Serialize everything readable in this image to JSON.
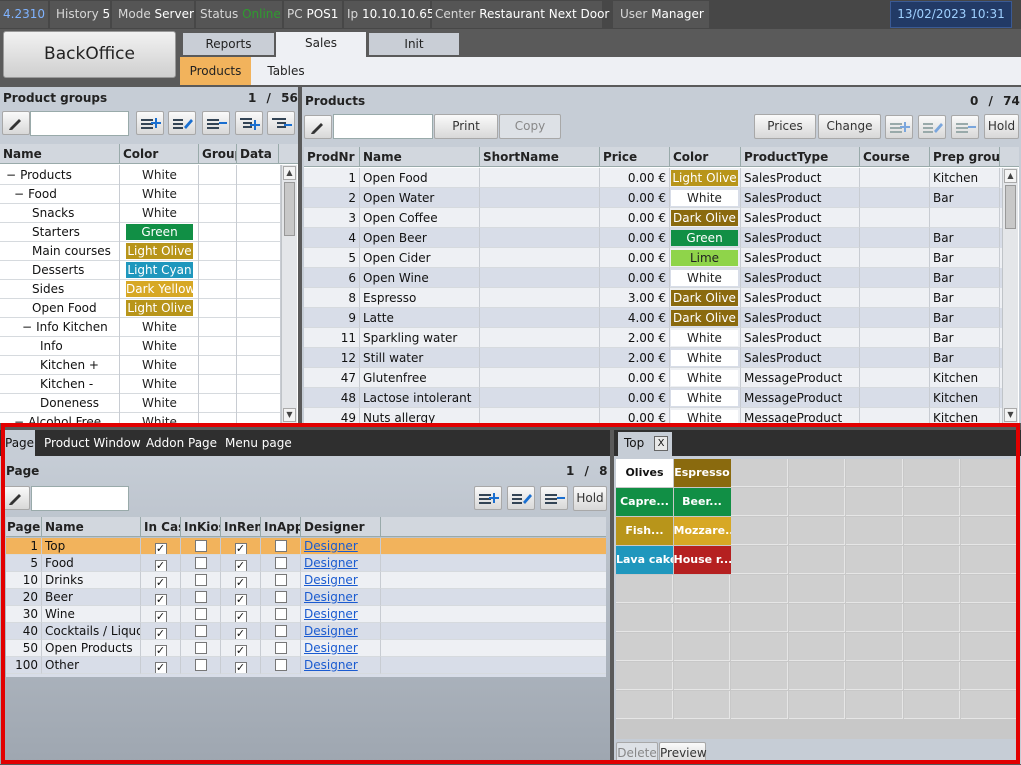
{
  "topbar": {
    "version": "4.2310",
    "history_label": "History",
    "history_value": "5",
    "mode_label": "Mode",
    "mode_value": "Server",
    "status_label": "Status",
    "status_value": "Online",
    "pc_label": "PC",
    "pc_value": "POS1",
    "ip_label": "Ip",
    "ip_value": "10.10.10.65",
    "center_label": "Center",
    "center_value": "Restaurant Next Door",
    "user_label": "User",
    "user_value": "Manager",
    "datetime": "13/02/2023 10:31"
  },
  "backoffice_label": "BackOffice",
  "main_tabs": [
    {
      "label": "Reports",
      "active": false
    },
    {
      "label": "Sales",
      "active": true
    },
    {
      "label": "Init",
      "active": false
    }
  ],
  "sub_tabs": [
    {
      "label": "Products",
      "active": true
    },
    {
      "label": "Tables",
      "active": false
    }
  ],
  "product_groups": {
    "title": "Product groups",
    "count": "1 / 56",
    "columns": [
      "Name",
      "Color",
      "Group",
      "Data"
    ],
    "rows": [
      {
        "name": "Products",
        "prefix": "−",
        "color": "White",
        "bg": "#ffffff",
        "fg": "#222"
      },
      {
        "name": "Food",
        "prefix": "−",
        "color": "White",
        "bg": "#ffffff",
        "fg": "#222"
      },
      {
        "name": "Snacks",
        "prefix": "",
        "color": "White",
        "bg": "#ffffff",
        "fg": "#222"
      },
      {
        "name": "Starters",
        "prefix": "",
        "color": "Green",
        "bg": "#118f45",
        "fg": "#ffffff"
      },
      {
        "name": "Main courses",
        "prefix": "",
        "color": "Light Olive",
        "bg": "#b8951a",
        "fg": "#ffffff"
      },
      {
        "name": "Desserts",
        "prefix": "",
        "color": "Light Cyan",
        "bg": "#1f97bd",
        "fg": "#ffffff"
      },
      {
        "name": "Sides",
        "prefix": "",
        "color": "Dark Yellow",
        "bg": "#d7a825",
        "fg": "#ffffff"
      },
      {
        "name": "Open Food",
        "prefix": "",
        "color": "Light Olive",
        "bg": "#b8951a",
        "fg": "#ffffff"
      },
      {
        "name": "Info Kitchen",
        "prefix": "−",
        "color": "White",
        "bg": "#ffffff",
        "fg": "#222"
      },
      {
        "name": "Info",
        "prefix": "",
        "color": "White",
        "bg": "#ffffff",
        "fg": "#222"
      },
      {
        "name": "Kitchen +",
        "prefix": "",
        "color": "White",
        "bg": "#ffffff",
        "fg": "#222"
      },
      {
        "name": "Kitchen -",
        "prefix": "",
        "color": "White",
        "bg": "#ffffff",
        "fg": "#222"
      },
      {
        "name": "Doneness",
        "prefix": "",
        "color": "White",
        "bg": "#ffffff",
        "fg": "#222"
      },
      {
        "name": "Alcohol Free",
        "prefix": "−",
        "color": "White",
        "bg": "#ffffff",
        "fg": "#222"
      }
    ]
  },
  "products": {
    "title": "Products",
    "count": "0 / 74",
    "buttons": {
      "print": "Print",
      "copy": "Copy",
      "prices": "Prices",
      "change": "Change",
      "hold": "Hold"
    },
    "columns": [
      "ProdNr",
      "Name",
      "ShortName",
      "Price",
      "Color",
      "ProductType",
      "Course",
      "Prep group"
    ],
    "rows": [
      {
        "nr": "1",
        "name": "Open Food",
        "short": "",
        "price": "0.00 €",
        "color": "Light Olive",
        "bg": "#b8951a",
        "fg": "#fff",
        "type": "SalesProduct",
        "course": "",
        "prep": "Kitchen"
      },
      {
        "nr": "2",
        "name": "Open Water",
        "short": "",
        "price": "0.00 €",
        "color": "White",
        "bg": "#fff",
        "fg": "#222",
        "type": "SalesProduct",
        "course": "",
        "prep": "Bar"
      },
      {
        "nr": "3",
        "name": "Open Coffee",
        "short": "",
        "price": "0.00 €",
        "color": "Dark Olive",
        "bg": "#8a6a0e",
        "fg": "#fff",
        "type": "SalesProduct",
        "course": "",
        "prep": ""
      },
      {
        "nr": "4",
        "name": "Open Beer",
        "short": "",
        "price": "0.00 €",
        "color": "Green",
        "bg": "#118f45",
        "fg": "#fff",
        "type": "SalesProduct",
        "course": "",
        "prep": "Bar"
      },
      {
        "nr": "5",
        "name": "Open Cider",
        "short": "",
        "price": "0.00 €",
        "color": "Lime",
        "bg": "#8fd44a",
        "fg": "#222",
        "type": "SalesProduct",
        "course": "",
        "prep": "Bar"
      },
      {
        "nr": "6",
        "name": "Open Wine",
        "short": "",
        "price": "0.00 €",
        "color": "White",
        "bg": "#fff",
        "fg": "#222",
        "type": "SalesProduct",
        "course": "",
        "prep": "Bar"
      },
      {
        "nr": "8",
        "name": "Espresso",
        "short": "",
        "price": "3.00 €",
        "color": "Dark Olive",
        "bg": "#8a6a0e",
        "fg": "#fff",
        "type": "SalesProduct",
        "course": "",
        "prep": "Bar"
      },
      {
        "nr": "9",
        "name": "Latte",
        "short": "",
        "price": "4.00 €",
        "color": "Dark Olive",
        "bg": "#8a6a0e",
        "fg": "#fff",
        "type": "SalesProduct",
        "course": "",
        "prep": "Bar"
      },
      {
        "nr": "11",
        "name": "Sparkling water",
        "short": "",
        "price": "2.00 €",
        "color": "White",
        "bg": "#fff",
        "fg": "#222",
        "type": "SalesProduct",
        "course": "",
        "prep": "Bar"
      },
      {
        "nr": "12",
        "name": "Still water",
        "short": "",
        "price": "2.00 €",
        "color": "White",
        "bg": "#fff",
        "fg": "#222",
        "type": "SalesProduct",
        "course": "",
        "prep": "Bar"
      },
      {
        "nr": "47",
        "name": "Glutenfree",
        "short": "",
        "price": "0.00 €",
        "color": "White",
        "bg": "#fff",
        "fg": "#222",
        "type": "MessageProduct",
        "course": "",
        "prep": "Kitchen"
      },
      {
        "nr": "48",
        "name": "Lactose intolerant",
        "short": "",
        "price": "0.00 €",
        "color": "White",
        "bg": "#fff",
        "fg": "#222",
        "type": "MessageProduct",
        "course": "",
        "prep": "Kitchen"
      },
      {
        "nr": "49",
        "name": "Nuts allergy",
        "short": "",
        "price": "0.00 €",
        "color": "White",
        "bg": "#fff",
        "fg": "#222",
        "type": "MessageProduct",
        "course": "",
        "prep": "Kitchen"
      }
    ]
  },
  "bottom_tabs": [
    {
      "label": "Page",
      "active": true
    },
    {
      "label": "Product Window",
      "active": false
    },
    {
      "label": "Addon Page",
      "active": false
    },
    {
      "label": "Menu page",
      "active": false
    }
  ],
  "page_panel": {
    "title": "Page",
    "count": "1 / 8",
    "hold": "Hold",
    "columns": [
      "PageNr",
      "Name",
      "In Cash",
      "InKiosk",
      "InRemote",
      "InApp",
      "Designer"
    ],
    "rows": [
      {
        "nr": "1",
        "name": "Top",
        "cash": true,
        "kiosk": false,
        "remote": true,
        "app": false,
        "designer": "Designer",
        "selected": true
      },
      {
        "nr": "5",
        "name": "Food",
        "cash": true,
        "kiosk": false,
        "remote": true,
        "app": false,
        "designer": "Designer",
        "selected": false
      },
      {
        "nr": "10",
        "name": "Drinks",
        "cash": true,
        "kiosk": false,
        "remote": true,
        "app": false,
        "designer": "Designer",
        "selected": false
      },
      {
        "nr": "20",
        "name": "Beer",
        "cash": true,
        "kiosk": false,
        "remote": true,
        "app": false,
        "designer": "Designer",
        "selected": false
      },
      {
        "nr": "30",
        "name": "Wine",
        "cash": true,
        "kiosk": false,
        "remote": true,
        "app": false,
        "designer": "Designer",
        "selected": false
      },
      {
        "nr": "40",
        "name": "Cocktails / Liquor",
        "cash": true,
        "kiosk": false,
        "remote": true,
        "app": false,
        "designer": "Designer",
        "selected": false
      },
      {
        "nr": "50",
        "name": "Open Products",
        "cash": true,
        "kiosk": false,
        "remote": true,
        "app": false,
        "designer": "Designer",
        "selected": false
      },
      {
        "nr": "100",
        "name": "Other",
        "cash": true,
        "kiosk": false,
        "remote": true,
        "app": false,
        "designer": "Designer",
        "selected": false
      }
    ]
  },
  "layout_panel": {
    "tab": "Top",
    "close": "X",
    "buttons": [
      {
        "label": "Olives",
        "bg": "#ffffff",
        "fg": "#111"
      },
      {
        "label": "Espresso",
        "bg": "#8a6a0e",
        "fg": "#fff"
      },
      {
        "label": "Capre...",
        "bg": "#118f45",
        "fg": "#fff"
      },
      {
        "label": "Beer...",
        "bg": "#118f45",
        "fg": "#fff"
      },
      {
        "label": "Fish...",
        "bg": "#b8951a",
        "fg": "#fff"
      },
      {
        "label": "Mozzare...",
        "bg": "#d7a825",
        "fg": "#fff"
      },
      {
        "label": "Lava cake",
        "bg": "#1f97bd",
        "fg": "#fff"
      },
      {
        "label": "House r...",
        "bg": "#b52020",
        "fg": "#fff"
      }
    ],
    "delete": "Delete",
    "preview": "Preview"
  }
}
